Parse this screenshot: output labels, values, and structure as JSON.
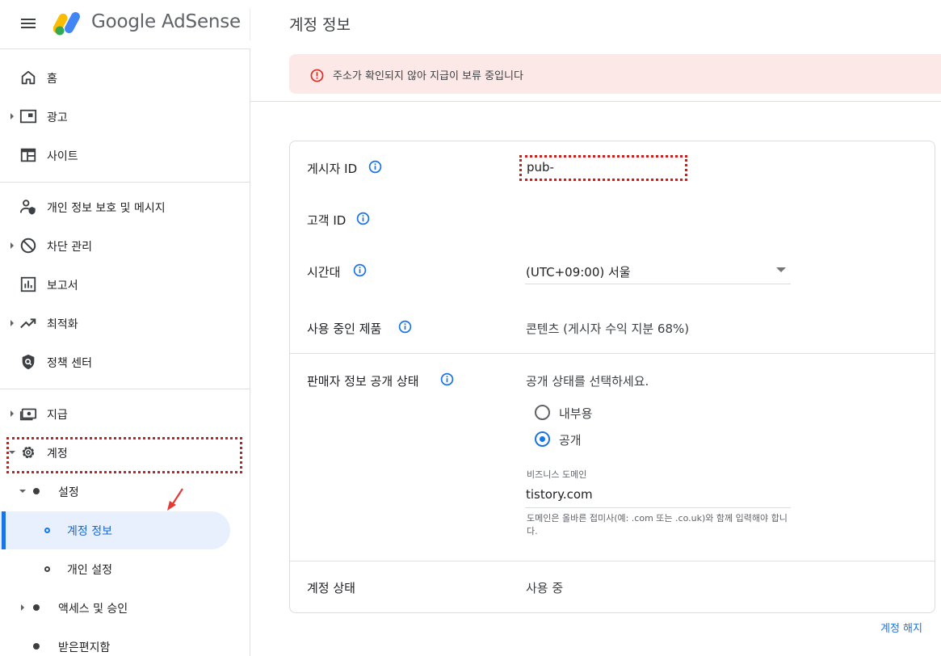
{
  "header": {
    "app_name": "Google AdSense",
    "page_title": "계정 정보",
    "menu_icon": "hamburger-menu-icon"
  },
  "alert": {
    "icon": "error-circle-icon",
    "text": "주소가 확인되지 않아 지급이 보류 중입니다",
    "color": "#fce8e6"
  },
  "sidebar": {
    "items": [
      {
        "label": "홈",
        "icon": "home-icon"
      },
      {
        "label": "광고",
        "icon": "ads-icon"
      },
      {
        "label": "사이트",
        "icon": "sites-icon"
      },
      {
        "label": "개인 정보 보호 및 메시지",
        "icon": "privacy-messaging-icon"
      },
      {
        "label": "차단 관리",
        "icon": "block-icon"
      },
      {
        "label": "보고서",
        "icon": "reports-icon"
      },
      {
        "label": "최적화",
        "icon": "trending-up-icon"
      },
      {
        "label": "정책 센터",
        "icon": "policy-shield-icon"
      },
      {
        "label": "지급",
        "icon": "payments-icon"
      },
      {
        "label": "계정",
        "icon": "gear-icon"
      }
    ],
    "sub_items": [
      {
        "label": "설정"
      },
      {
        "label": "계정 정보"
      },
      {
        "label": "개인 설정"
      },
      {
        "label": "액세스 및 승인"
      },
      {
        "label": "받은편지함"
      }
    ],
    "active_color": "#1a73e8"
  },
  "account": {
    "publisher_id_label": "게시자 ID",
    "publisher_id_value": "pub-",
    "customer_id_label": "고객 ID",
    "timezone_label": "시간대",
    "timezone_value": "(UTC+09:00) 서울",
    "products_label": "사용 중인 제품",
    "products_value": "콘텐츠 (게시자 수익 지분 68%)",
    "seller_label": "판매자 정보 공개 상태",
    "seller_prompt": "공개 상태를 선택하세요.",
    "radio_options": [
      {
        "label": "내부용",
        "selected": false
      },
      {
        "label": "공개",
        "selected": true
      }
    ],
    "domain_caption": "비즈니스 도메인",
    "domain_value": "tistory.com",
    "domain_helper": "도메인은 올바른 접미사(예: .com 또는 .co.uk)와 함께 입력해야 합니다.",
    "status_label": "계정 상태",
    "status_value": "사용 중"
  },
  "footer": {
    "close_account_link": "계정 해지"
  }
}
